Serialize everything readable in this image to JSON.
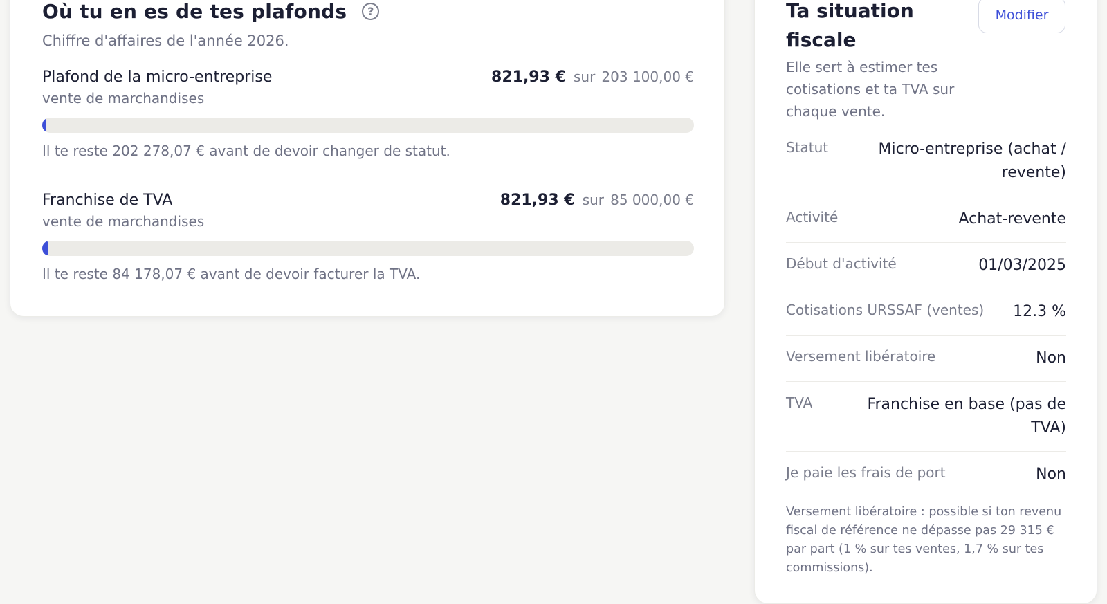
{
  "plafonds": {
    "title": "Où tu en es de tes plafonds",
    "help_glyph": "?",
    "subtitle": "Chiffre d'affaires de l'année 2026.",
    "limits": [
      {
        "name": "Plafond de la micro-entreprise",
        "sub": "vente de marchandises",
        "current": "821,93 €",
        "separator": "sur",
        "max": "203 100,00 €",
        "progress_fraction": 0.004,
        "remaining": "Il te reste 202 278,07 € avant de devoir changer de statut."
      },
      {
        "name": "Franchise de TVA",
        "sub": "vente de marchandises",
        "current": "821,93 €",
        "separator": "sur",
        "max": "85 000,00 €",
        "progress_fraction": 0.0097,
        "remaining": "Il te reste 84 178,07 € avant de devoir facturer la TVA."
      }
    ]
  },
  "fiscale": {
    "title": "Ta situation fiscale",
    "modify_label": "Modifier",
    "description": "Elle sert à estimer tes cotisations et ta TVA sur chaque vente.",
    "rows": [
      {
        "label": "Statut",
        "value": "Micro-entreprise (achat / revente)"
      },
      {
        "label": "Activité",
        "value": "Achat-revente"
      },
      {
        "label": "Début d'activité",
        "value": "01/03/2025"
      },
      {
        "label": "Cotisations URSSAF (ventes)",
        "value": "12.3 %"
      },
      {
        "label": "Versement libératoire",
        "value": "Non"
      },
      {
        "label": "TVA",
        "value": "Franchise en base (pas de TVA)"
      },
      {
        "label": "Je paie les frais de port",
        "value": "Non"
      }
    ],
    "note": "Versement libératoire : possible si ton revenu fiscal de référence ne dépasse pas 29 315 € par part (1 % sur tes ventes, 1,7 % sur tes commissions)."
  },
  "colors": {
    "accent": "#3d4fd8",
    "text_primary": "#1c1f33",
    "text_secondary": "#6f7285",
    "track": "#ecebe7"
  }
}
